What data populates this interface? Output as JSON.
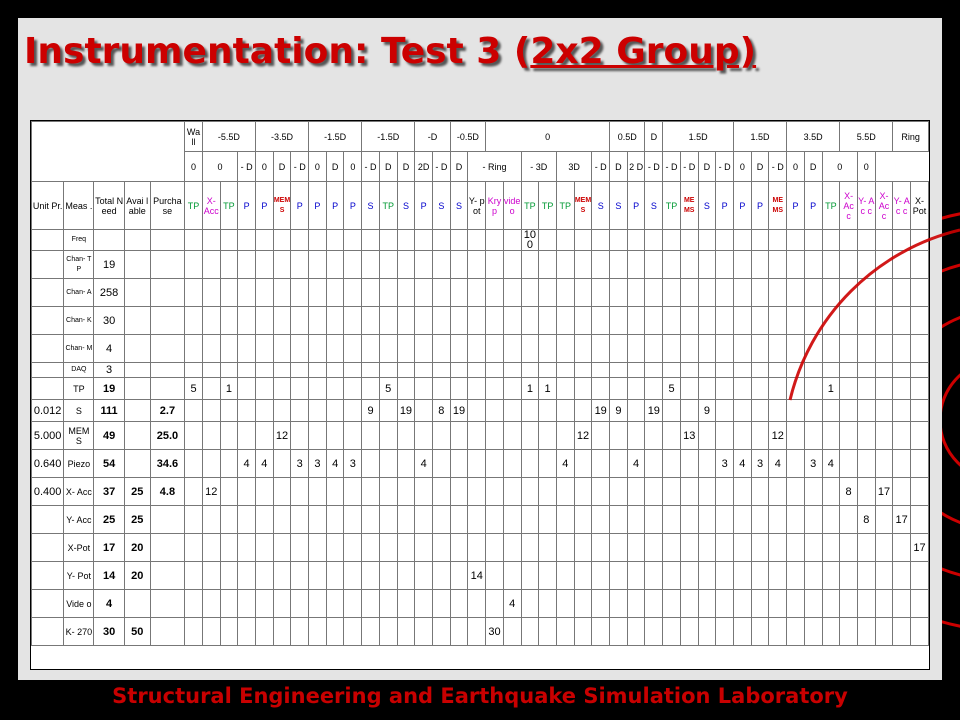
{
  "title": {
    "prefix": "Instrumentation: Test 3 (",
    "underlined": "2x2 Group)"
  },
  "footer": "Structural Engineering and Earthquake Simulation Laboratory",
  "table": {
    "header_row1": [
      "Wa ll",
      "-5.5D",
      "-3.5D",
      "-1.5D",
      "-1.5D",
      "-D",
      "-0.5D",
      "0",
      "0.5D",
      "D",
      "1.5D",
      "1.5D",
      "3.5D",
      "5.5D",
      "Ring"
    ],
    "header_row2": [
      "0",
      "0",
      "- D",
      "0",
      "D",
      "- D",
      "0",
      "D",
      "0",
      "- D",
      "D",
      "D",
      "2D",
      "- D",
      "D",
      "- Ring",
      "- 3D",
      "3D",
      "- D",
      "D",
      "2 D",
      "- D",
      "- D",
      "- D",
      "D",
      "- D",
      "0",
      "D",
      "- D",
      "0",
      "D",
      "0",
      "0"
    ],
    "top_left_labels": [
      "Unit Pr.",
      "Meas .",
      "Total Need",
      "Avai lable",
      "Purcha se"
    ],
    "type_row": [
      "TP",
      "X- Acc",
      "TP",
      "P",
      "P",
      "MEM S",
      "P",
      "P",
      "P",
      "P",
      "S",
      "TP",
      "S",
      "P",
      "S",
      "S",
      "Y- pot",
      "Kry p",
      "vide o",
      "TP",
      "TP",
      "TP",
      "MEM S",
      "S",
      "S",
      "P",
      "S",
      "TP",
      "ME MS",
      "S",
      "P",
      "P",
      "P",
      "ME MS",
      "P",
      "P",
      "TP",
      "X- Ac c",
      "Y- Ac c",
      "X- Ac c",
      "Y- Ac c",
      "X- Pot"
    ],
    "channel_rows": [
      {
        "label": "Freq",
        "total": "",
        "value": "100"
      },
      {
        "label": "Chan- TP",
        "total": "19",
        "value": ""
      },
      {
        "label": "Chan- A",
        "total": "258",
        "value": ""
      },
      {
        "label": "Chan- K",
        "total": "30",
        "value": ""
      },
      {
        "label": "Chan- M",
        "total": "4",
        "value": ""
      },
      {
        "label": "DAQ",
        "total": "3",
        "value": ""
      }
    ],
    "rows": [
      {
        "unit": "",
        "meas": "TP",
        "total": "19",
        "avail": "",
        "purch": "",
        "cells": [
          [
            0,
            "5"
          ],
          [
            2,
            "1"
          ],
          [
            11,
            "5"
          ],
          [
            19,
            "1"
          ],
          [
            20,
            "1"
          ],
          [
            27,
            "5"
          ],
          [
            36,
            "1"
          ]
        ]
      },
      {
        "unit": "0.012",
        "meas": "S",
        "total": "111",
        "avail": "",
        "purch": "2.7",
        "cells": [
          [
            10,
            "9"
          ],
          [
            12,
            "19"
          ],
          [
            14,
            "8"
          ],
          [
            15,
            "19"
          ],
          [
            23,
            "19"
          ],
          [
            24,
            "9"
          ],
          [
            26,
            "19"
          ],
          [
            29,
            "9"
          ]
        ]
      },
      {
        "unit": "5.000",
        "meas": "MEM S",
        "total": "49",
        "avail": "",
        "purch": "25.0",
        "cells": [
          [
            5,
            "12"
          ],
          [
            22,
            "12"
          ],
          [
            28,
            "13"
          ],
          [
            33,
            "12"
          ]
        ]
      },
      {
        "unit": "0.640",
        "meas": "Piezo",
        "total": "54",
        "avail": "",
        "purch": "34.6",
        "cells": [
          [
            3,
            "4"
          ],
          [
            4,
            "4"
          ],
          [
            6,
            "3"
          ],
          [
            7,
            "3"
          ],
          [
            8,
            "4"
          ],
          [
            9,
            "3"
          ],
          [
            13,
            "4"
          ],
          [
            21,
            "4"
          ],
          [
            25,
            "4"
          ],
          [
            30,
            "3"
          ],
          [
            31,
            "4"
          ],
          [
            32,
            "3"
          ],
          [
            33,
            "4"
          ],
          [
            35,
            "3"
          ],
          [
            36,
            "4"
          ]
        ]
      },
      {
        "unit": "0.400",
        "meas": "X- Acc",
        "total": "37",
        "avail": "25",
        "purch": "4.8",
        "cells": [
          [
            1,
            "12"
          ],
          [
            37,
            "8"
          ],
          [
            39,
            "17"
          ]
        ]
      },
      {
        "unit": "",
        "meas": "Y- Acc",
        "total": "25",
        "avail": "25",
        "purch": "",
        "cells": [
          [
            38,
            "8"
          ],
          [
            40,
            "17"
          ]
        ]
      },
      {
        "unit": "",
        "meas": "X-Pot",
        "total": "17",
        "avail": "20",
        "purch": "",
        "cells": [
          [
            41,
            "17"
          ]
        ]
      },
      {
        "unit": "",
        "meas": "Y- Pot",
        "total": "14",
        "avail": "20",
        "purch": "",
        "cells": [
          [
            16,
            "14"
          ]
        ]
      },
      {
        "unit": "",
        "meas": "Vide o",
        "total": "4",
        "avail": "",
        "purch": "",
        "cells": [
          [
            18,
            "4"
          ]
        ]
      },
      {
        "unit": "",
        "meas": "K- 270",
        "total": "30",
        "avail": "50",
        "purch": "",
        "cells": [
          [
            17,
            "30"
          ]
        ]
      }
    ]
  },
  "colors": {
    "title": "#cc0000",
    "footer": "#c80000",
    "background": "#000000",
    "slide": "#e4e4e4",
    "circles": "#cc0000"
  }
}
